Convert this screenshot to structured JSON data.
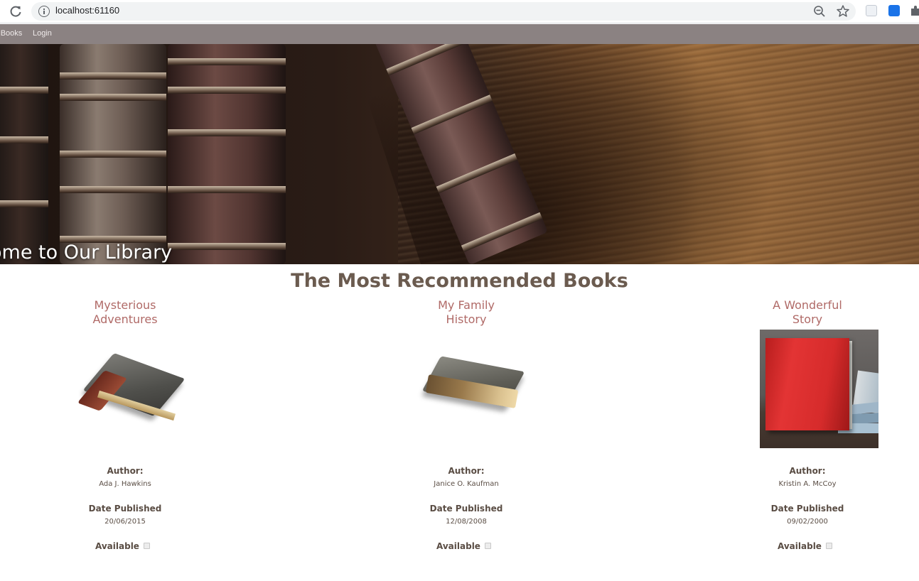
{
  "browser": {
    "url": "localhost:61160",
    "icons": [
      "reload-icon",
      "info-icon",
      "zoom-out-icon",
      "star-icon",
      "extension-icon",
      "extension-icon",
      "puzzle-icon"
    ]
  },
  "nav": {
    "books_label": "r Books",
    "login_label": "Login"
  },
  "hero": {
    "title": "ome to Our Library"
  },
  "main": {
    "section_title": "The Most Recommended Books",
    "books": [
      {
        "title": "Mysterious Adventures",
        "author_label": "Author:",
        "author": "Ada J. Hawkins",
        "date_label": "Date Published",
        "date": "20/06/2015",
        "available_label": "Available"
      },
      {
        "title": "My Family History",
        "author_label": "Author:",
        "author": "Janice O. Kaufman",
        "date_label": "Date Published",
        "date": "12/08/2008",
        "available_label": "Available"
      },
      {
        "title": "A Wonderful Story",
        "author_label": "Author:",
        "author": "Kristin A. McCoy",
        "date_label": "Date Published",
        "date": "09/02/2000",
        "available_label": "Available"
      }
    ]
  },
  "colors": {
    "nav_bg": "#8b8282",
    "section_title": "#6b5b4f",
    "book_title": "#b06a67",
    "text": "#5a4d44"
  }
}
